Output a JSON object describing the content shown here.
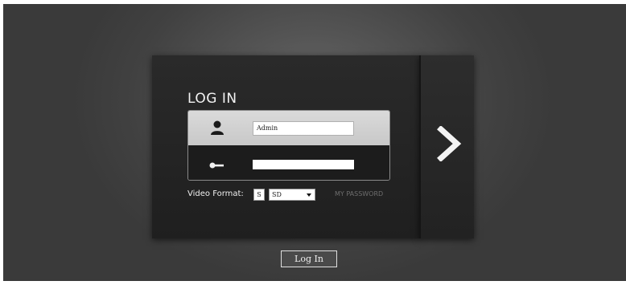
{
  "login": {
    "title": "LOG IN",
    "username_value": "Admin",
    "password_value": "",
    "video_format_label": "Video Format:",
    "stream_value": "S",
    "format_selected": "SD",
    "my_password_link": "MY PASSWORD",
    "login_button_label": "Log In"
  },
  "icons": {
    "user": "user-icon",
    "key": "key-icon",
    "next": "chevron-right-icon",
    "dropdown": "caret-down-icon"
  },
  "colors": {
    "panel": "#222222",
    "user_row": "#d4d4d4",
    "text_light": "#f2f2f2",
    "link_muted": "#6e6e6e"
  }
}
